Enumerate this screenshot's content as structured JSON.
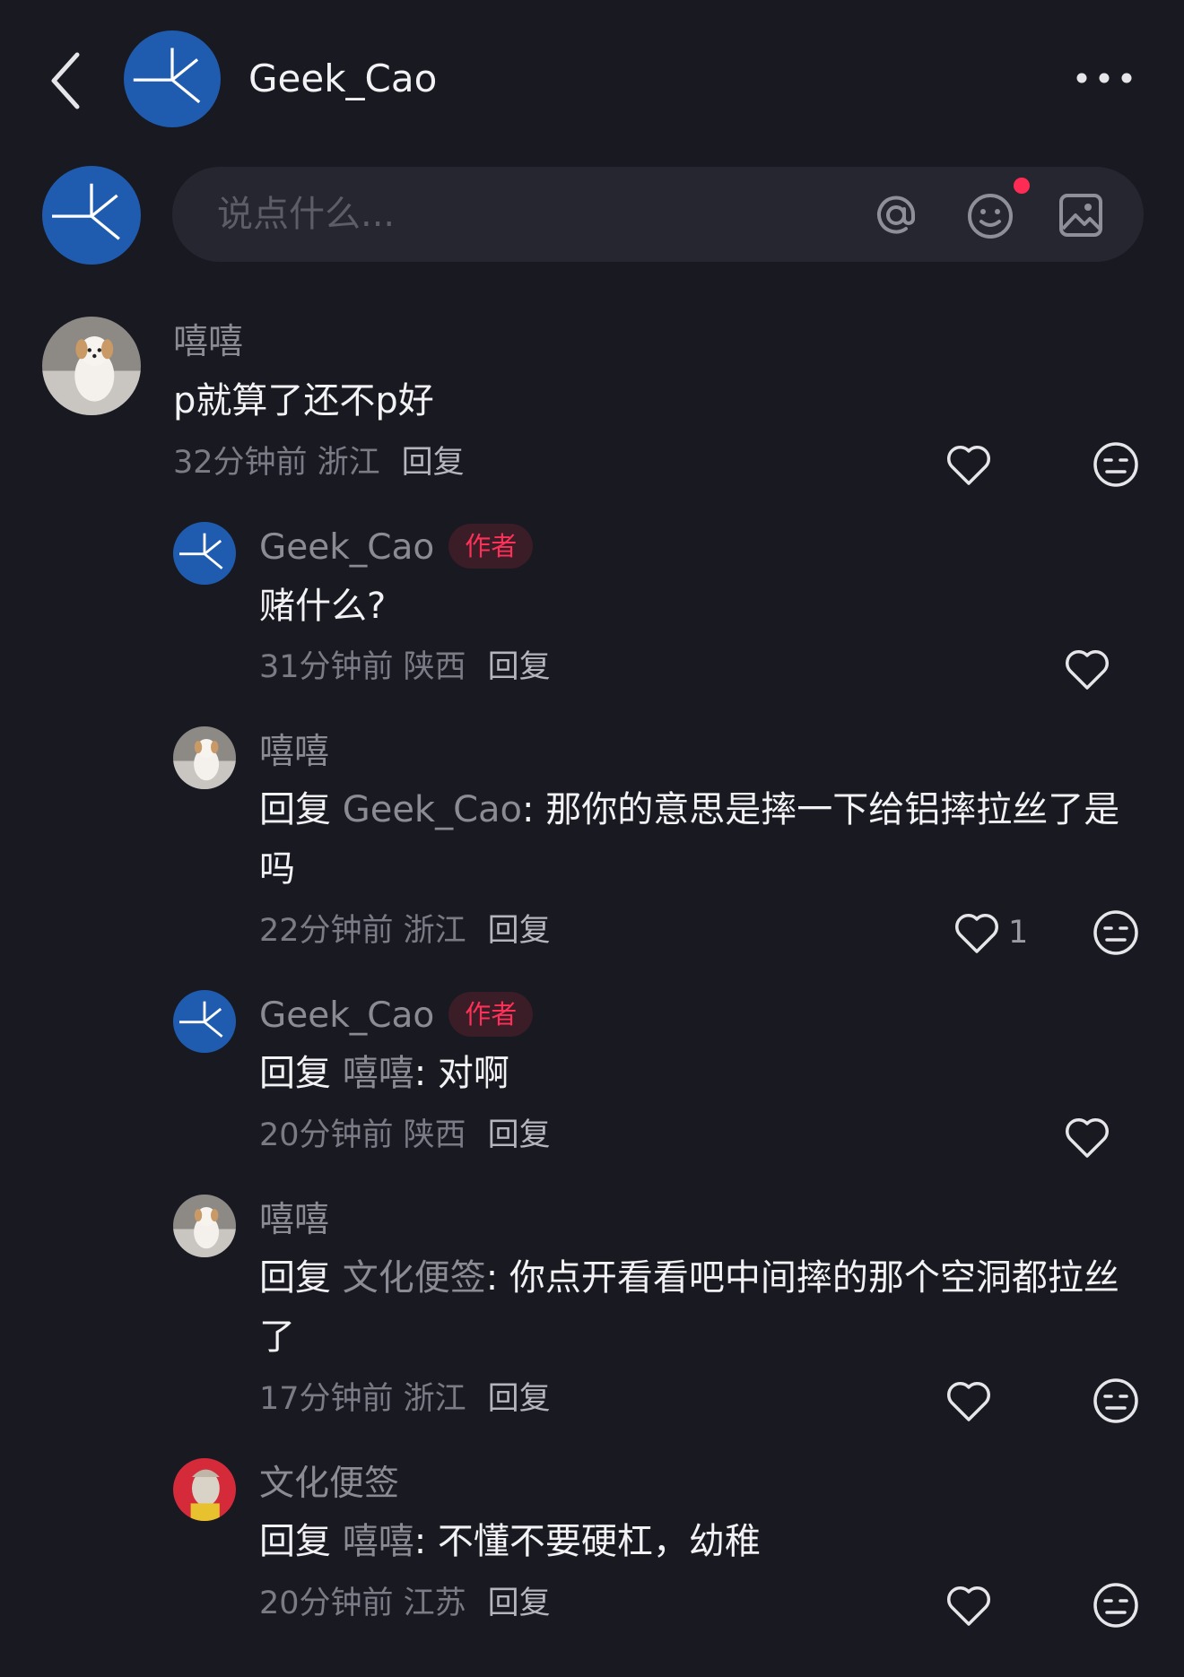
{
  "header": {
    "author_name": "Geek_Cao",
    "back_icon": "chevron-left-icon",
    "more_icon": "more-horizontal-icon"
  },
  "composer": {
    "placeholder": "说点什么...",
    "icons": [
      "at-icon",
      "emoji-icon",
      "image-icon"
    ],
    "notification_dot_color": "#fe2c55"
  },
  "comments": [
    {
      "user": "嘻嘻",
      "is_author": false,
      "text": "p就算了还不p好",
      "time_location": "32分钟前 浙江",
      "reply_label": "回复",
      "likes": ""
    },
    {
      "user": "Geek_Cao",
      "is_author": true,
      "badge": "作者",
      "text": "赌什么?",
      "time_location": "31分钟前 陕西",
      "reply_label": "回复",
      "likes": ""
    },
    {
      "user": "嘻嘻",
      "is_author": false,
      "reply_prefix": "回复",
      "reply_to": "Geek_Cao",
      "text": ": 那你的意思是摔一下给铝摔拉丝了是吗",
      "time_location": "22分钟前 浙江",
      "reply_label": "回复",
      "likes": "1"
    },
    {
      "user": "Geek_Cao",
      "is_author": true,
      "badge": "作者",
      "reply_prefix": "回复",
      "reply_to": "嘻嘻",
      "text": ": 对啊",
      "time_location": "20分钟前 陕西",
      "reply_label": "回复",
      "likes": ""
    },
    {
      "user": "嘻嘻",
      "is_author": false,
      "reply_prefix": "回复",
      "reply_to": "文化便签",
      "text": ": 你点开看看吧中间摔的那个空洞都拉丝了",
      "time_location": "17分钟前 浙江",
      "reply_label": "回复",
      "likes": ""
    },
    {
      "user": "文化便签",
      "is_author": false,
      "reply_prefix": "回复",
      "reply_to": "嘻嘻",
      "text": ": 不懂不要硬杠，幼稚",
      "time_location": "20分钟前 江苏",
      "reply_label": "回复",
      "likes": ""
    }
  ],
  "colors": {
    "background": "#191921",
    "author_badge_text": "#ff3058",
    "author_avatar_blue": "#1f5cb0"
  }
}
